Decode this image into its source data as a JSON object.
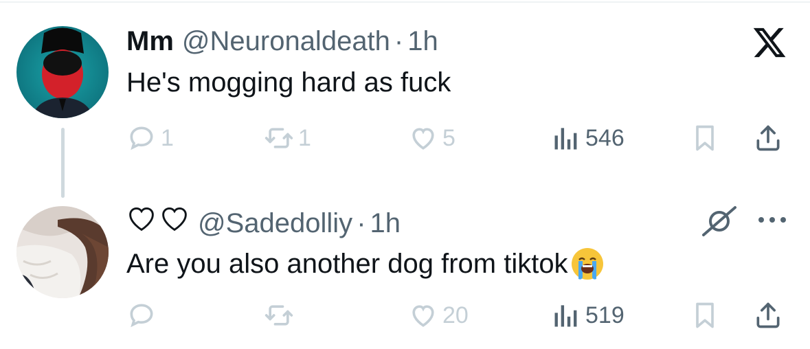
{
  "tweets": [
    {
      "name": "Mm",
      "handle": "@Neuronaldeath",
      "separator": "·",
      "time": "1h",
      "text": "He's mogging hard as fuck",
      "replies": "1",
      "retweets": "1",
      "likes": "5",
      "views": "546"
    },
    {
      "name_icons": [
        "heart-outline-icon",
        "heart-outline-icon"
      ],
      "handle": "@Sadedolliy",
      "separator": "·",
      "time": "1h",
      "text": "Are you also another dog from tiktok",
      "text_emoji": "loudly-crying-face-emoji",
      "replies": "",
      "retweets": "",
      "likes": "20",
      "views": "519"
    }
  ],
  "colors": {
    "text_primary": "#0f1419",
    "text_secondary": "#536471",
    "faded_action": "#c4cfd6",
    "thread_line": "#cfd9de"
  },
  "icons": {
    "brand": "x-logo-icon",
    "grok": "grok-icon",
    "more": "more-icon"
  }
}
